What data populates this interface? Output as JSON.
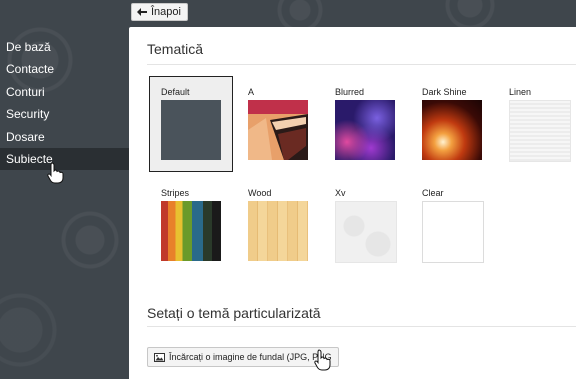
{
  "toolbar": {
    "back_label": "Înapoi"
  },
  "sidebar": {
    "items": [
      {
        "label": "De bază"
      },
      {
        "label": "Contacte"
      },
      {
        "label": "Conturi"
      },
      {
        "label": "Security"
      },
      {
        "label": "Dosare"
      },
      {
        "label": "Subiecte",
        "active": true
      }
    ]
  },
  "main": {
    "themes_title": "Tematică",
    "themes": [
      {
        "label": "Default",
        "selected": true
      },
      {
        "label": "A"
      },
      {
        "label": "Blurred"
      },
      {
        "label": "Dark Shine"
      },
      {
        "label": "Linen"
      },
      {
        "label": "Stripes"
      },
      {
        "label": "Wood"
      },
      {
        "label": "Xv"
      },
      {
        "label": "Clear"
      }
    ],
    "custom_title": "Setați o temă particularizată",
    "upload_label": "Încărcați o imagine de fundal (JPG, PNG"
  },
  "icons": {
    "back": "arrow-left-icon",
    "upload": "image-icon",
    "cursor": "hand-pointer-icon"
  },
  "colors": {
    "page_bg": "#3f464c",
    "active_nav_bg": "#2a2f33",
    "content_bg": "#ffffff"
  }
}
